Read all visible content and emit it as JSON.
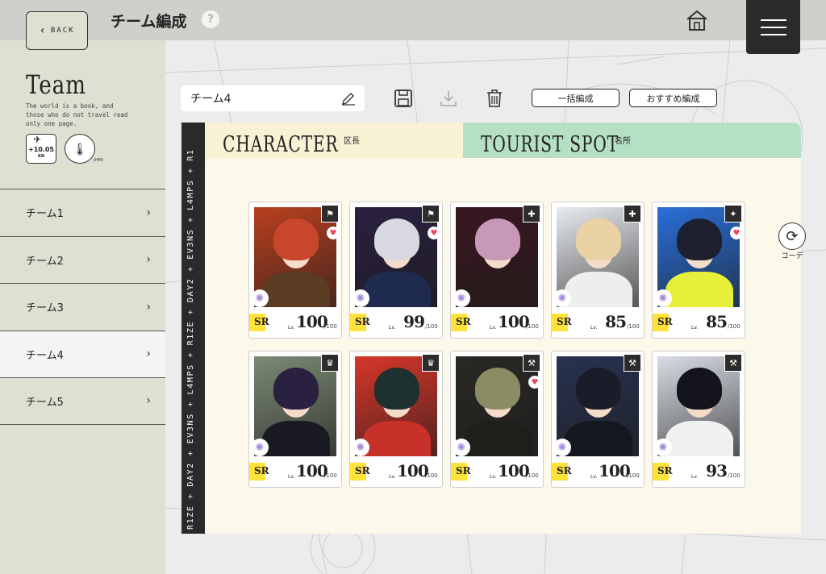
{
  "header": {
    "back_label": "BACK",
    "title": "チーム編成",
    "help_glyph": "?"
  },
  "sidebar": {
    "heading": "Team",
    "description": "The world is a book, and those who do not travel read only one page.",
    "speed_value": "+10.05",
    "speed_unit": "KN",
    "thermo_label": "(HM)",
    "teams": [
      {
        "label": "チーム1",
        "active": false
      },
      {
        "label": "チーム2",
        "active": false
      },
      {
        "label": "チーム3",
        "active": false
      },
      {
        "label": "チーム4",
        "active": true
      },
      {
        "label": "チーム5",
        "active": false
      }
    ]
  },
  "toolbar": {
    "team_name": "チーム4",
    "bulk_label": "一括編成",
    "recommend_label": "おすすめ編成"
  },
  "panel": {
    "ribbon_text": "R1ZE + DAY2 + EV3NS + L4MPS + R1ZE + DAY2 + EV3NS + L4MPS + R1",
    "character_tab": "CHARACTER",
    "character_sub": "区長",
    "tourist_tab": "TOURIST SPOT",
    "tourist_sub": "名所",
    "code_label": "コーデ"
  },
  "cards": [
    {
      "rarity": "SR",
      "lv_label": "Lv.",
      "level": "100",
      "max": "/100",
      "icon": "flag-icon",
      "glyph": "⚑",
      "heart": true,
      "hair": "#c8472c",
      "bg": "#b8401f",
      "body": "#5a3c22"
    },
    {
      "rarity": "SR",
      "lv_label": "Lv.",
      "level": "99",
      "max": "/100",
      "icon": "flag-icon",
      "glyph": "⚑",
      "heart": true,
      "hair": "#d8d8e0",
      "bg": "#2a2040",
      "body": "#1f2a50"
    },
    {
      "rarity": "SR",
      "lv_label": "Lv.",
      "level": "100",
      "max": "/100",
      "icon": "kit-icon",
      "glyph": "✚",
      "heart": false,
      "hair": "#c898b8",
      "bg": "#3a1620",
      "body": "#2a1a1a"
    },
    {
      "rarity": "SR",
      "lv_label": "Lv.",
      "level": "85",
      "max": "/100",
      "icon": "kit-icon",
      "glyph": "✚",
      "heart": false,
      "hair": "#ead2a4",
      "bg": "#e8ebef",
      "body": "#eeeeee"
    },
    {
      "rarity": "SR",
      "lv_label": "Lv.",
      "level": "85",
      "max": "/100",
      "icon": "hairdryer-icon",
      "glyph": "✦",
      "heart": true,
      "hair": "#1e2030",
      "bg": "#2a6fd8",
      "body": "#e6f03a"
    },
    {
      "rarity": "SR",
      "lv_label": "Lv.",
      "level": "100",
      "max": "/100",
      "icon": "crown-icon",
      "glyph": "♛",
      "heart": false,
      "hair": "#2a2040",
      "bg": "#7c8a74",
      "body": "#1a1a22"
    },
    {
      "rarity": "SR",
      "lv_label": "Lv.",
      "level": "100",
      "max": "/100",
      "icon": "crown-icon",
      "glyph": "♛",
      "heart": false,
      "hair": "#1e3030",
      "bg": "#d8362a",
      "body": "#c8302a"
    },
    {
      "rarity": "SR",
      "lv_label": "Lv.",
      "level": "100",
      "max": "/100",
      "icon": "wrench-icon",
      "glyph": "⚒",
      "heart": true,
      "hair": "#8a8c64",
      "bg": "#2a2824",
      "body": "#1e1e1a"
    },
    {
      "rarity": "SR",
      "lv_label": "Lv.",
      "level": "100",
      "max": "/100",
      "icon": "wrench-icon",
      "glyph": "⚒",
      "heart": false,
      "hair": "#1a1c2a",
      "bg": "#283250",
      "body": "#141620"
    },
    {
      "rarity": "SR",
      "lv_label": "Lv.",
      "level": "93",
      "max": "/100",
      "icon": "wrench-icon",
      "glyph": "⚒",
      "heart": false,
      "hair": "#14141c",
      "bg": "#d8dce4",
      "body": "#f0f0f0"
    }
  ],
  "colors": {
    "sidebar": "#dfe0d2",
    "character_tab": "#f8f1d4",
    "tourist_tab": "#b6e0c3",
    "rarity": "#ffe23a"
  }
}
